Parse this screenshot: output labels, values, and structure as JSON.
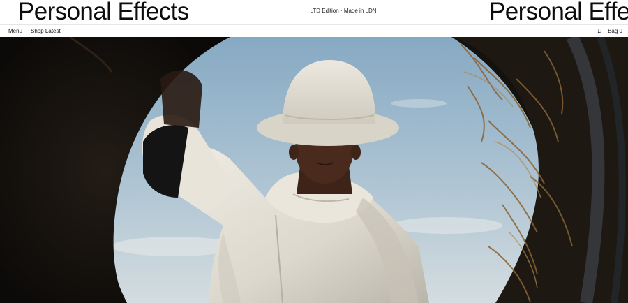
{
  "brand": {
    "name": "Personal Effects",
    "name_repeat": "Personal Effects",
    "tagline": "LTD Edition · Made in LDN"
  },
  "nav": {
    "menu_label": "Menu",
    "shop_latest_label": "Shop Latest",
    "currency_label": "£",
    "bag_label": "Bag 0"
  },
  "hero": {
    "icon": "hero-photo",
    "colors": {
      "sky_top": "#8fb2cc",
      "sky_bottom": "#c9d6dc",
      "tire": "#141210",
      "garment": "#e6e2d8",
      "skin": "#4a2a1c"
    }
  }
}
